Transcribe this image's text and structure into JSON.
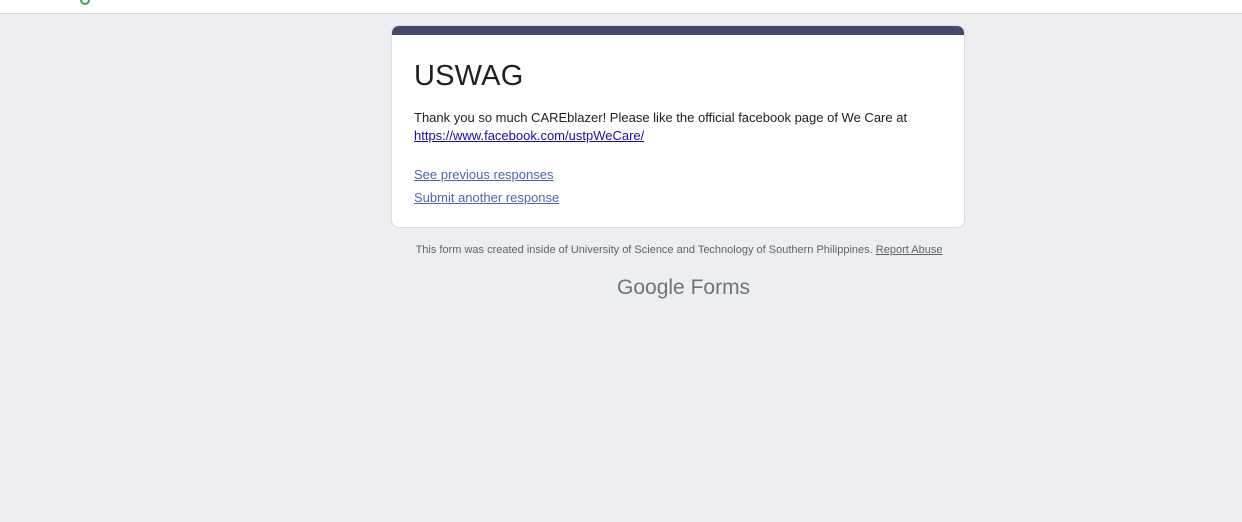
{
  "colors": {
    "background": "#eceef2",
    "card_accent": "#434a6b",
    "link": "#4e64b4",
    "url_link": "#1a0dab"
  },
  "form": {
    "title": "USWAG",
    "confirmation_message": "Thank you so much CAREblazer! Please like the official facebook page of We Care at",
    "confirmation_url": "https://www.facebook.com/ustpWeCare/",
    "see_previous_label": "See previous responses",
    "submit_another_label": "Submit another response"
  },
  "footer": {
    "created_inside_text": "This form was created inside of University of Science and Technology of Southern Philippines.",
    "report_abuse_label": "Report Abuse",
    "brand_google": "Google",
    "brand_forms": "Forms"
  }
}
